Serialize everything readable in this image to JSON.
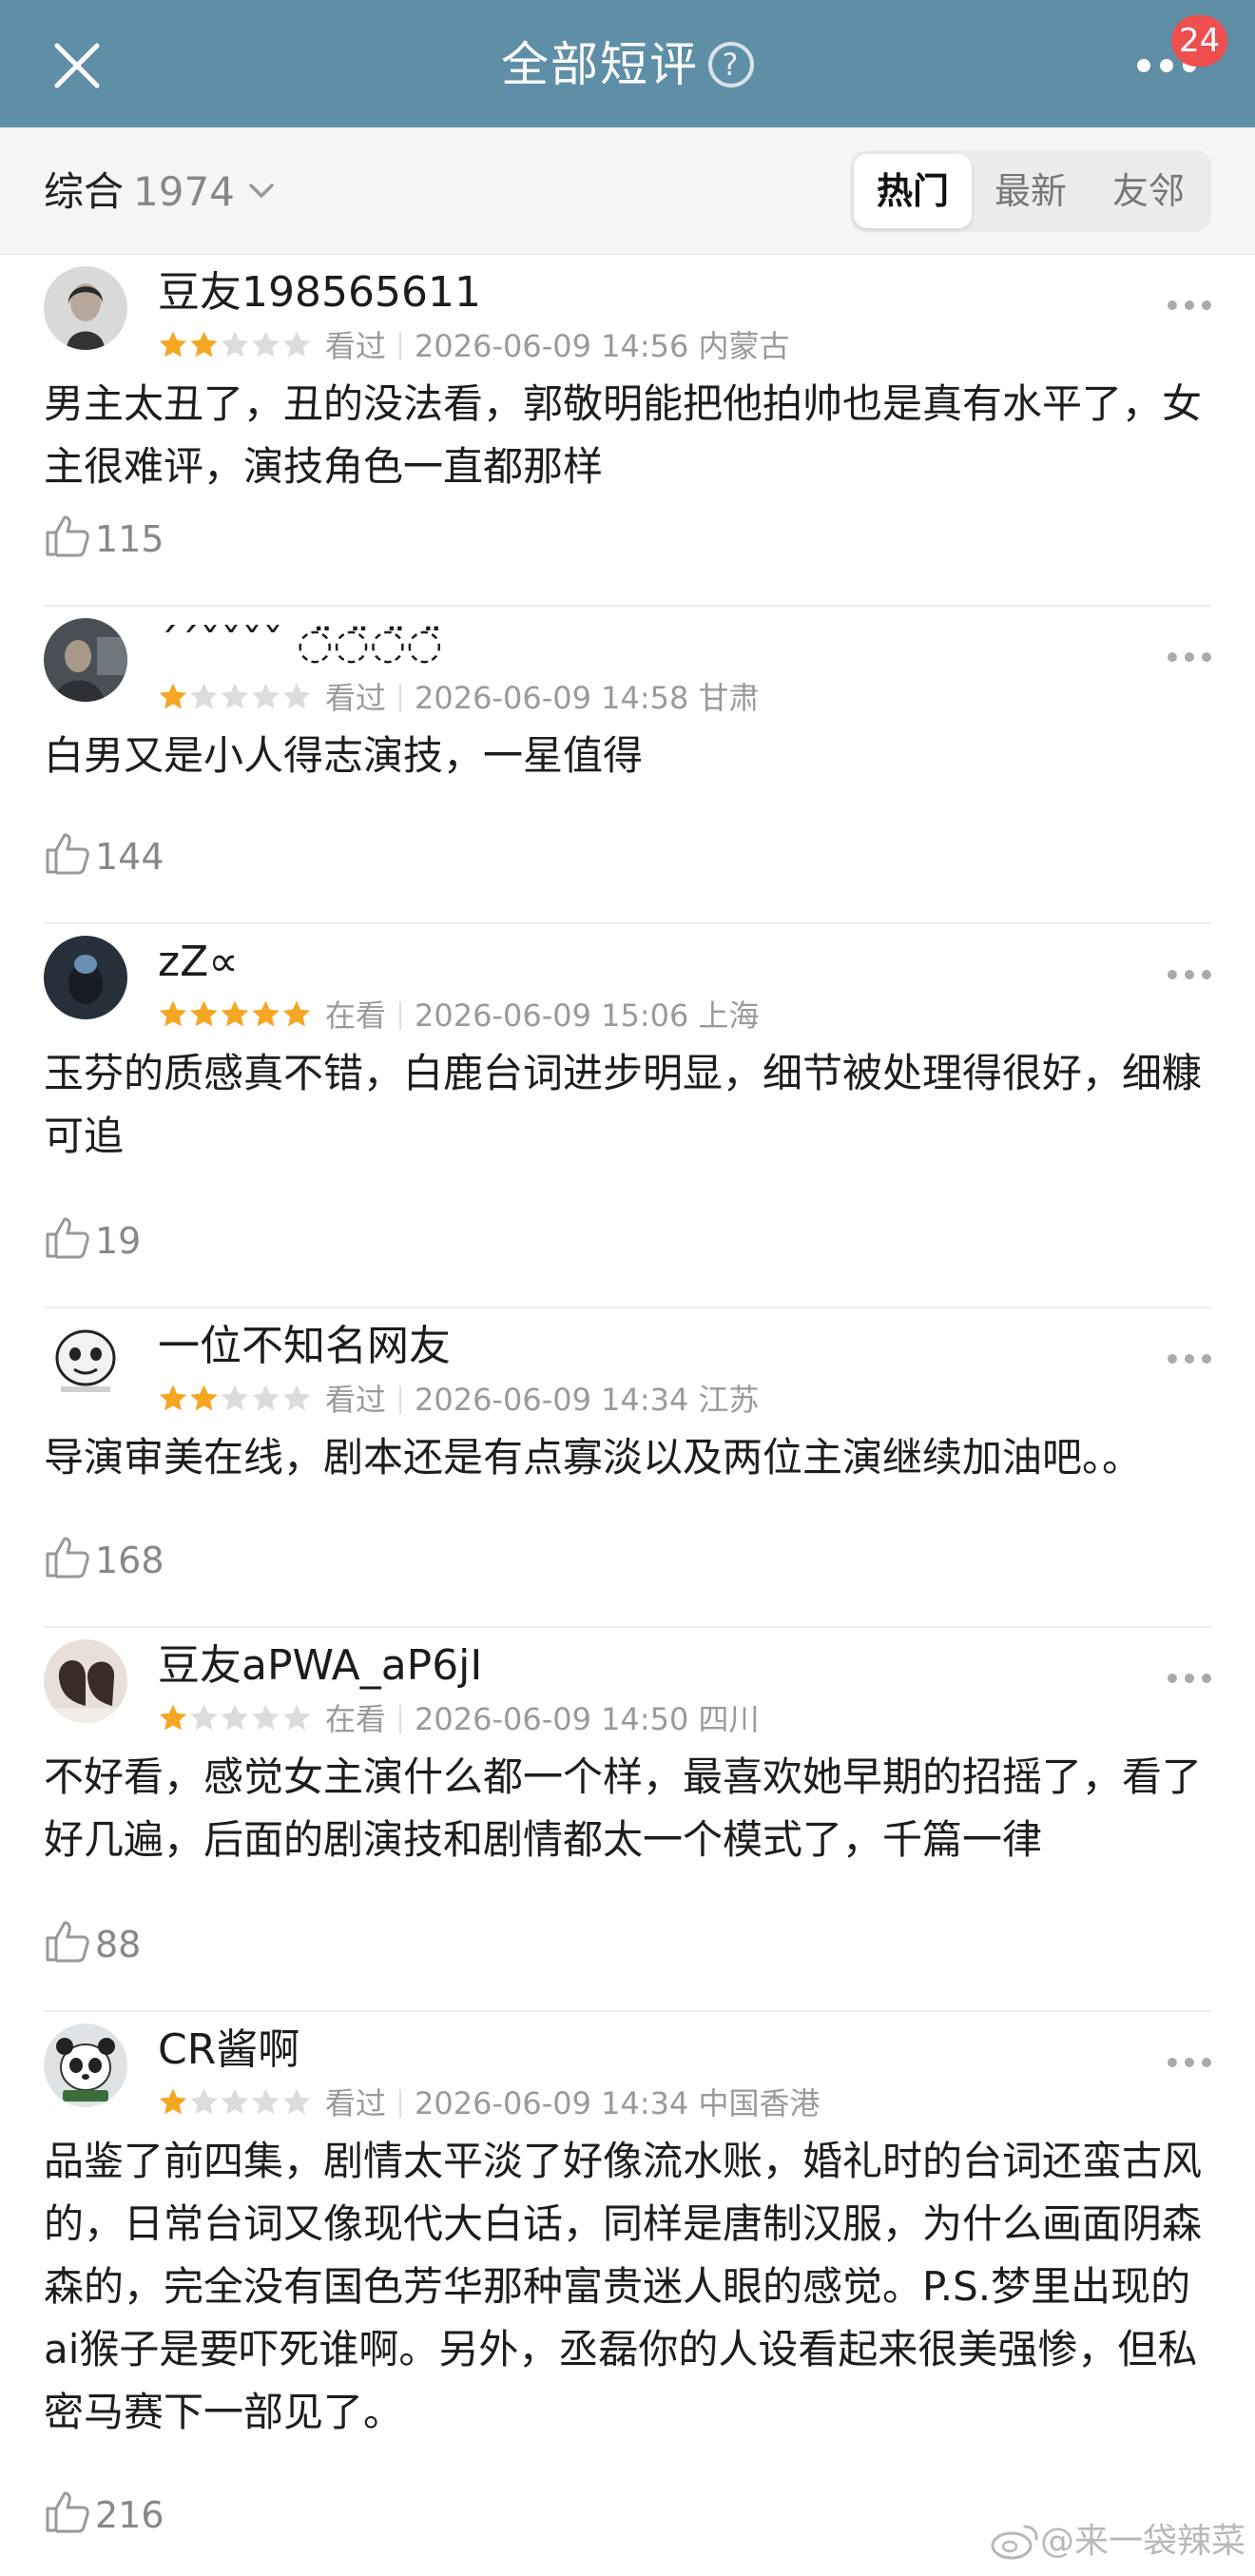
{
  "header": {
    "title": "全部短评",
    "badge_count": "24"
  },
  "filter": {
    "sort_label": "综合",
    "sort_count": "1974",
    "tabs": [
      "热门",
      "最新",
      "友邻"
    ],
    "active_tab": "热门"
  },
  "reviews": [
    {
      "username": "豆友198565611",
      "rating": 2,
      "status": "看过",
      "timestamp": "2026-06-09 14:56 内蒙古",
      "content": "男主太丑了，丑的没法看，郭敬明能把他拍帅也是真有水平了，女主很难评，演技角色一直都那样",
      "likes": "115"
    },
    {
      "username": "´´ˇˇˇˇ ◌̈◌̈◌̈◌̈",
      "rating": 1,
      "status": "看过",
      "timestamp": "2026-06-09 14:58 甘肃",
      "content": "白男又是小人得志演技，一星值得",
      "likes": "144"
    },
    {
      "username": "zZ∝",
      "rating": 5,
      "status": "在看",
      "timestamp": "2026-06-09 15:06 上海",
      "content": "玉芬的质感真不错，白鹿台词进步明显，细节被处理得很好，细糠可追",
      "likes": "19"
    },
    {
      "username": "一位不知名网友",
      "rating": 2,
      "status": "看过",
      "timestamp": "2026-06-09 14:34 江苏",
      "content": "导演审美在线，剧本还是有点寡淡以及两位主演继续加油吧。。",
      "likes": "168"
    },
    {
      "username": "豆友aPWA_aP6jI",
      "rating": 1,
      "status": "在看",
      "timestamp": "2026-06-09 14:50 四川",
      "content": "不好看，感觉女主演什么都一个样，最喜欢她早期的招摇了，看了好几遍，后面的剧演技和剧情都太一个模式了，千篇一律",
      "likes": "88"
    },
    {
      "username": "CR酱啊",
      "rating": 1,
      "status": "看过",
      "timestamp": "2026-06-09 14:34 中国香港",
      "content": "品鉴了前四集，剧情太平淡了好像流水账，婚礼时的台词还蛮古风的，日常台词又像现代大白话，同样是唐制汉服，为什么画面阴森森的，完全没有国色芳华那种富贵迷人眼的感觉。P.S.梦里出现的ai猴子是要吓死谁啊。另外，丞磊你的人设看起来很美强惨，但私密马赛下一部见了。",
      "likes": "216"
    }
  ],
  "watermark": "@来一袋辣菜",
  "colors": {
    "header_bg": "#5f8fa6",
    "star_filled": "#f5a623",
    "star_empty": "#dcdcdc",
    "badge": "#ee4e4e"
  }
}
